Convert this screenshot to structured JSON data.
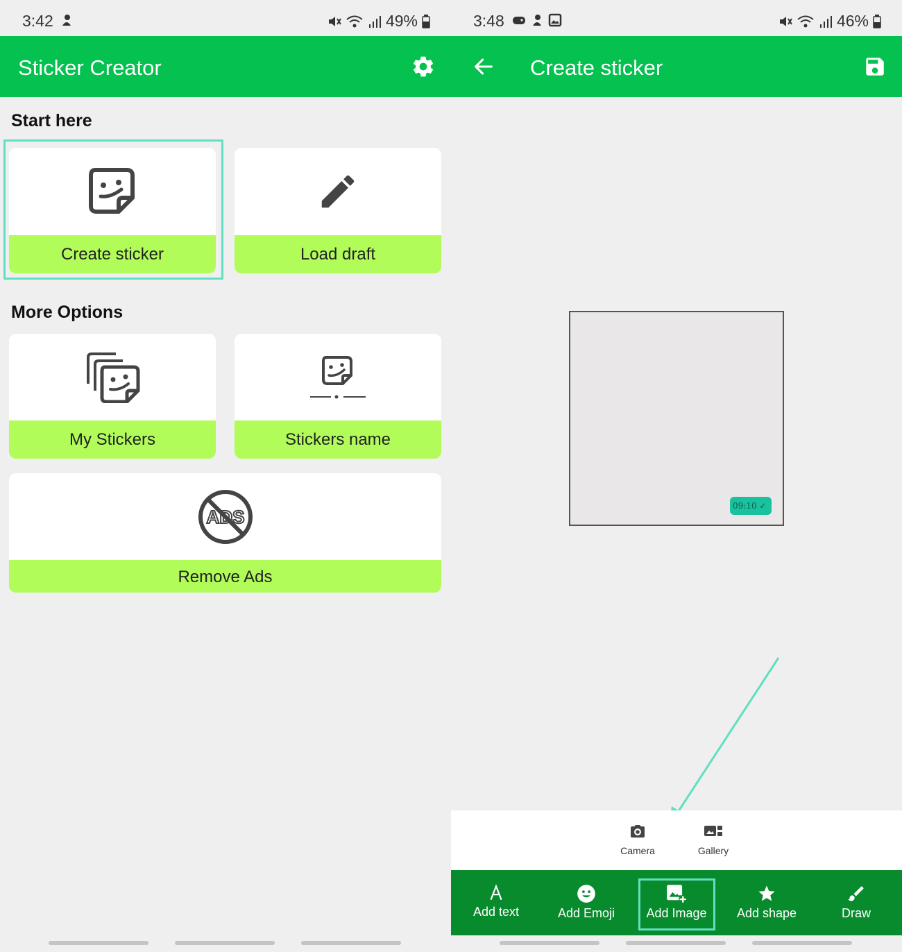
{
  "left": {
    "status": {
      "time": "3:42",
      "battery": "49%"
    },
    "appbar": {
      "title": "Sticker Creator"
    },
    "sections": {
      "start": "Start here",
      "more": "More Options"
    },
    "cards": {
      "create": "Create sticker",
      "load": "Load draft",
      "my_stickers": "My Stickers",
      "stickers_name": "Stickers name",
      "remove_ads": "Remove Ads",
      "ads_icon_text": "ADS"
    }
  },
  "right": {
    "status": {
      "time": "3:48",
      "battery": "46%"
    },
    "appbar": {
      "title": "Create sticker"
    },
    "canvas": {
      "time_badge": "09:10"
    },
    "sheet": {
      "camera": "Camera",
      "gallery": "Gallery"
    },
    "toolbar": {
      "add_text": "Add text",
      "add_emoji": "Add Emoji",
      "add_image": "Add Image",
      "add_shape": "Add shape",
      "draw": "Draw"
    }
  },
  "colors": {
    "primary_green": "#04c150",
    "toolbar_green": "#078b2c",
    "label_lime": "#b1fc59",
    "highlight_teal": "#62dec0"
  },
  "icons": [
    "settings-gear-icon",
    "sticker-icon",
    "pencil-icon",
    "stickers-stack-icon",
    "sticker-name-icon",
    "no-ads-icon",
    "back-arrow-icon",
    "save-floppy-icon",
    "camera-icon",
    "gallery-icon",
    "text-a-icon",
    "emoji-icon",
    "add-image-icon",
    "star-icon",
    "brush-icon"
  ]
}
